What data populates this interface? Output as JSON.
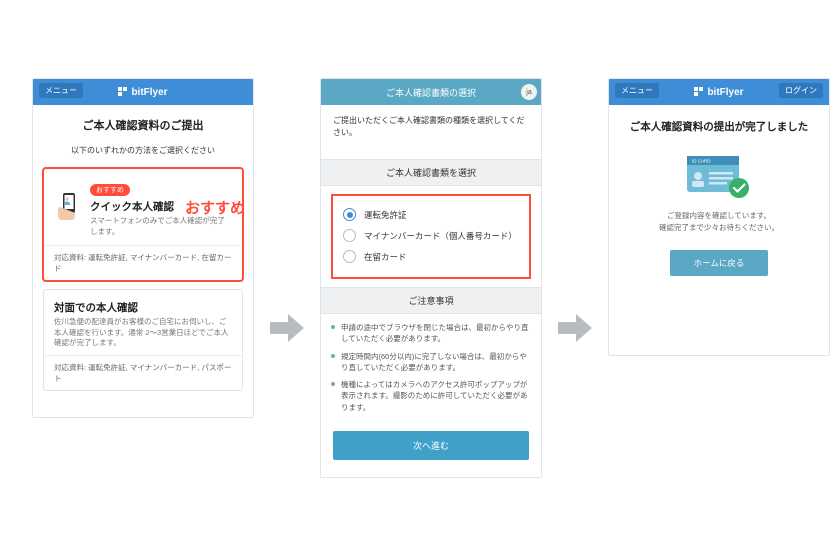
{
  "brand": "bitFlyer",
  "menu_label": "メニュー",
  "login_label": "ログイン",
  "lang_badge": "ja",
  "panel1": {
    "title": "ご本人確認資料のご提出",
    "subtitle": "以下のいずれかの方法をご選択ください",
    "highlight_label": "おすすめ",
    "quick": {
      "badge": "おすすめ",
      "title": "クイック本人確認",
      "desc": "スマートフォンのみでご本人確認が完了します。",
      "docs": "対応資料: 運転免許証, マイナンバーカード, 在留カード"
    },
    "inperson": {
      "title": "対面での本人確認",
      "desc": "佐川急便の配達員がお客様のご自宅にお伺いし、ご本人確認を行います。通常 2～3営業日ほどでご本人確認が完了します。",
      "docs": "対応資料: 運転免許証, マイナンバーカード, パスポート"
    }
  },
  "panel2": {
    "header": "ご本人確認書類の選択",
    "lead": "ご提出いただくご本人確認書類の種類を選択してください。",
    "section_select": "ご本人確認書類を選択",
    "options": {
      "opt0": "運転免許証",
      "opt1": "マイナンバーカード（個人番号カード）",
      "opt2": "在留カード"
    },
    "section_notes": "ご注意事項",
    "notes": {
      "n0": "申請の途中でブラウザを閉じた場合は、最初からやり直していただく必要があります。",
      "n1": "規定時間内(60分以内)に完了しない場合は、最初からやり直していただく必要があります。",
      "n2": "機種によってはカメラへのアクセス許可ポップアップが表示されます。撮影のために許可していただく必要があります。"
    },
    "next_label": "次へ進む"
  },
  "panel3": {
    "title": "ご本人確認資料の提出が完了しました",
    "card_label": "ID CARD",
    "msg_line1": "ご登録内容を確認しています。",
    "msg_line2": "確認完了まで少々お待ちください。",
    "home_label": "ホームに戻る"
  }
}
